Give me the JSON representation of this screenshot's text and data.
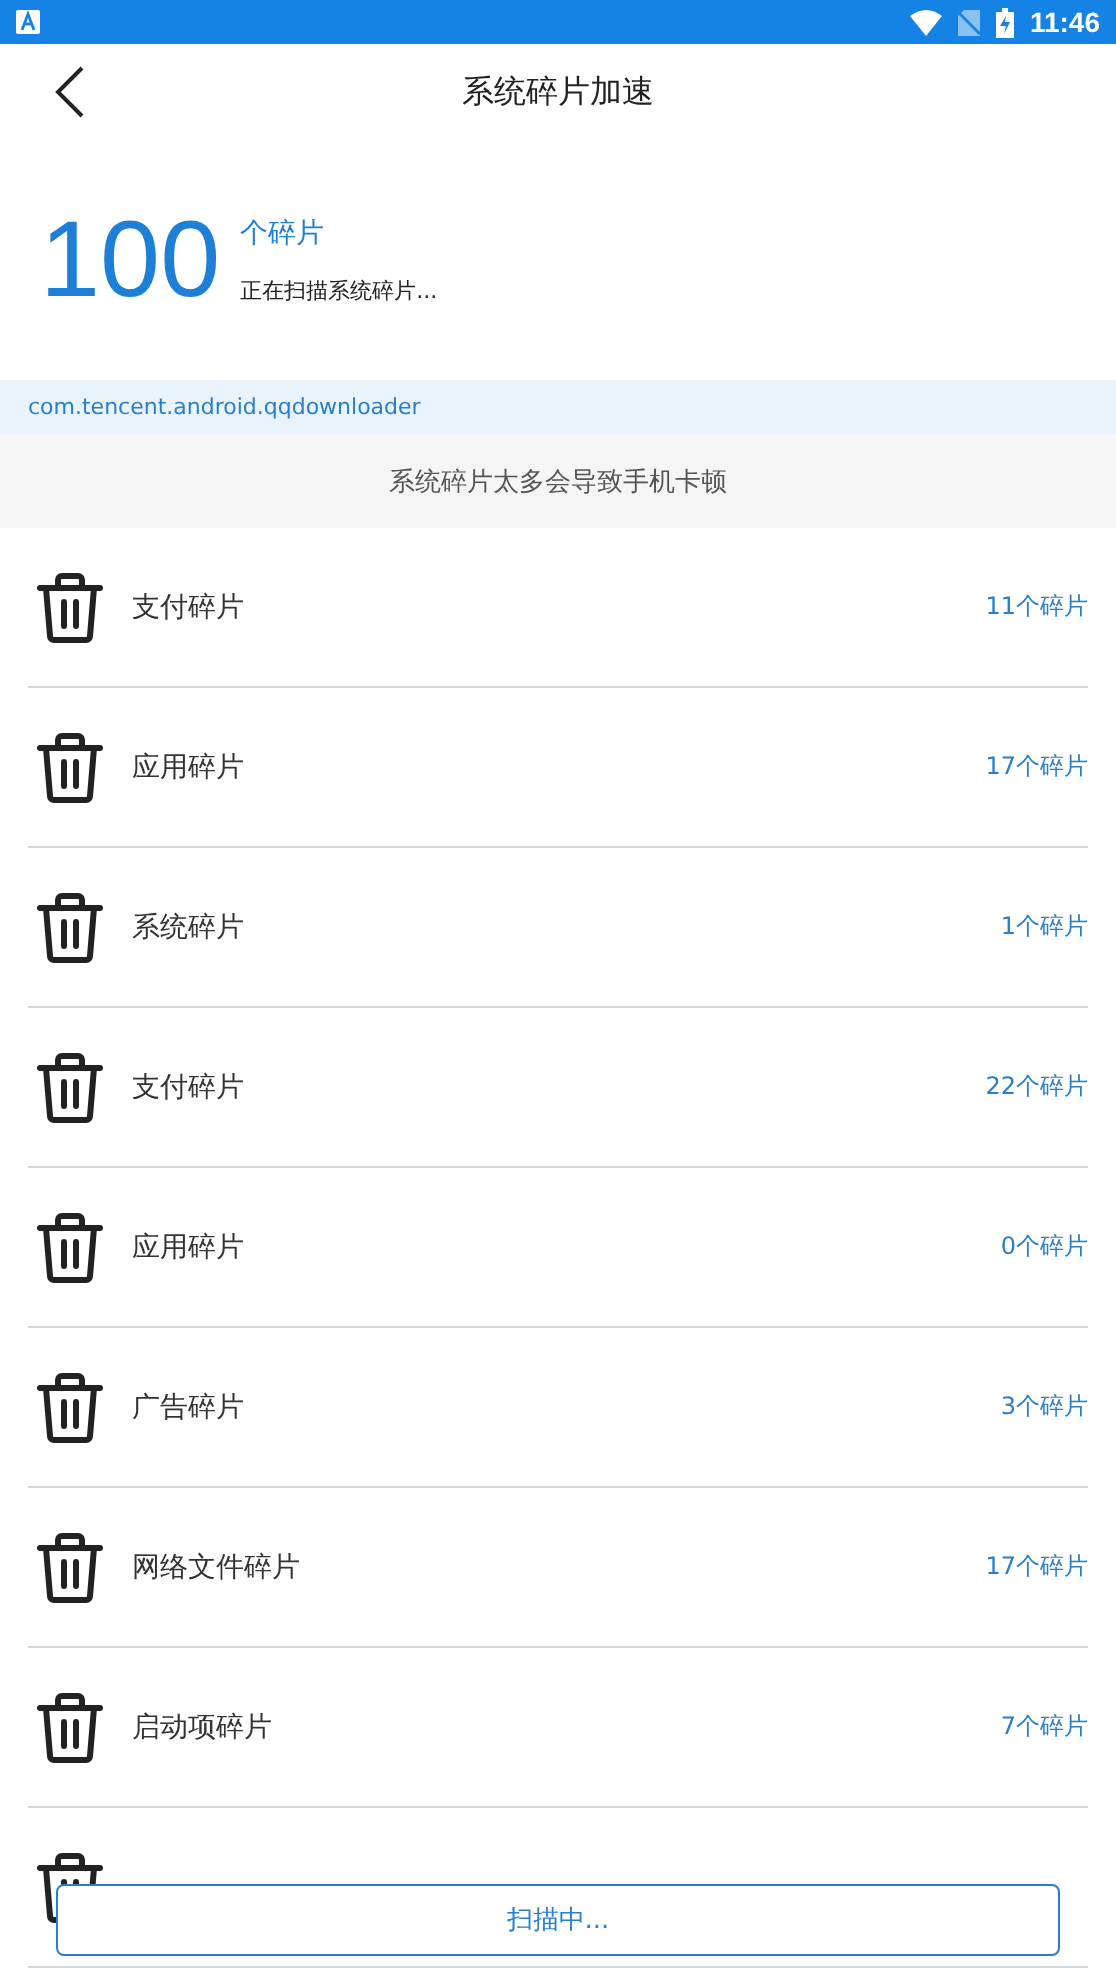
{
  "status_bar": {
    "time": "11:46"
  },
  "header": {
    "title": "系统碎片加速"
  },
  "summary": {
    "count": "100",
    "unit": "个碎片",
    "status": "正在扫描系统碎片..."
  },
  "current_package": "com.tencent.android.qqdownloader",
  "notice": "系统碎片太多会导致手机卡顿",
  "rows": [
    {
      "kind": "full",
      "label": "支付碎片",
      "count": "11个碎片"
    },
    {
      "kind": "full",
      "label": "应用碎片",
      "count": "17个碎片"
    },
    {
      "kind": "full",
      "label": "系统碎片",
      "count": "1个碎片"
    },
    {
      "kind": "full",
      "label": "支付碎片",
      "count": "22个碎片"
    },
    {
      "kind": "full",
      "label": "应用碎片",
      "count": "0个碎片"
    },
    {
      "kind": "full",
      "label": "广告碎片",
      "count": "3个碎片"
    },
    {
      "kind": "full",
      "label": "网络文件碎片",
      "count": "17个碎片"
    },
    {
      "kind": "full",
      "label": "启动项碎片",
      "count": "7个碎片"
    },
    {
      "kind": "clipped"
    }
  ],
  "scan_button": "扫描中..."
}
